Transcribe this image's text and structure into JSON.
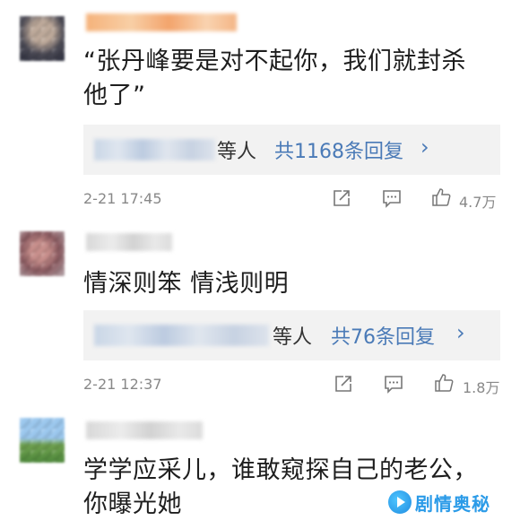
{
  "colors": {
    "link_blue": "#4a7ab7",
    "meta_gray": "#888888",
    "reply_bg": "#f2f2f2",
    "watermark_blue": "#2b9be8"
  },
  "comments": [
    {
      "text_line1": "“张丹峰要是对不起你，我们就封杀",
      "text_line2": "他了”",
      "reply_who": "等人",
      "reply_count": "共1168条回复",
      "chevron": "›",
      "time": "2-21 17:45",
      "likes": "4.7万"
    },
    {
      "text_line1": "情深则笨 情浅则明",
      "reply_who": "等人",
      "reply_count": "共76条回复",
      "chevron": "›",
      "time": "2-21 12:37",
      "likes": "1.8万"
    },
    {
      "text_line1": "学学应采儿，谁敢窥探自己的老公，",
      "text_line2": "你曝光她"
    }
  ],
  "icons": [
    "share-icon",
    "comment-icon",
    "like-icon",
    "watermark-logo-icon"
  ],
  "watermark": {
    "text": "剧情奥秘"
  }
}
